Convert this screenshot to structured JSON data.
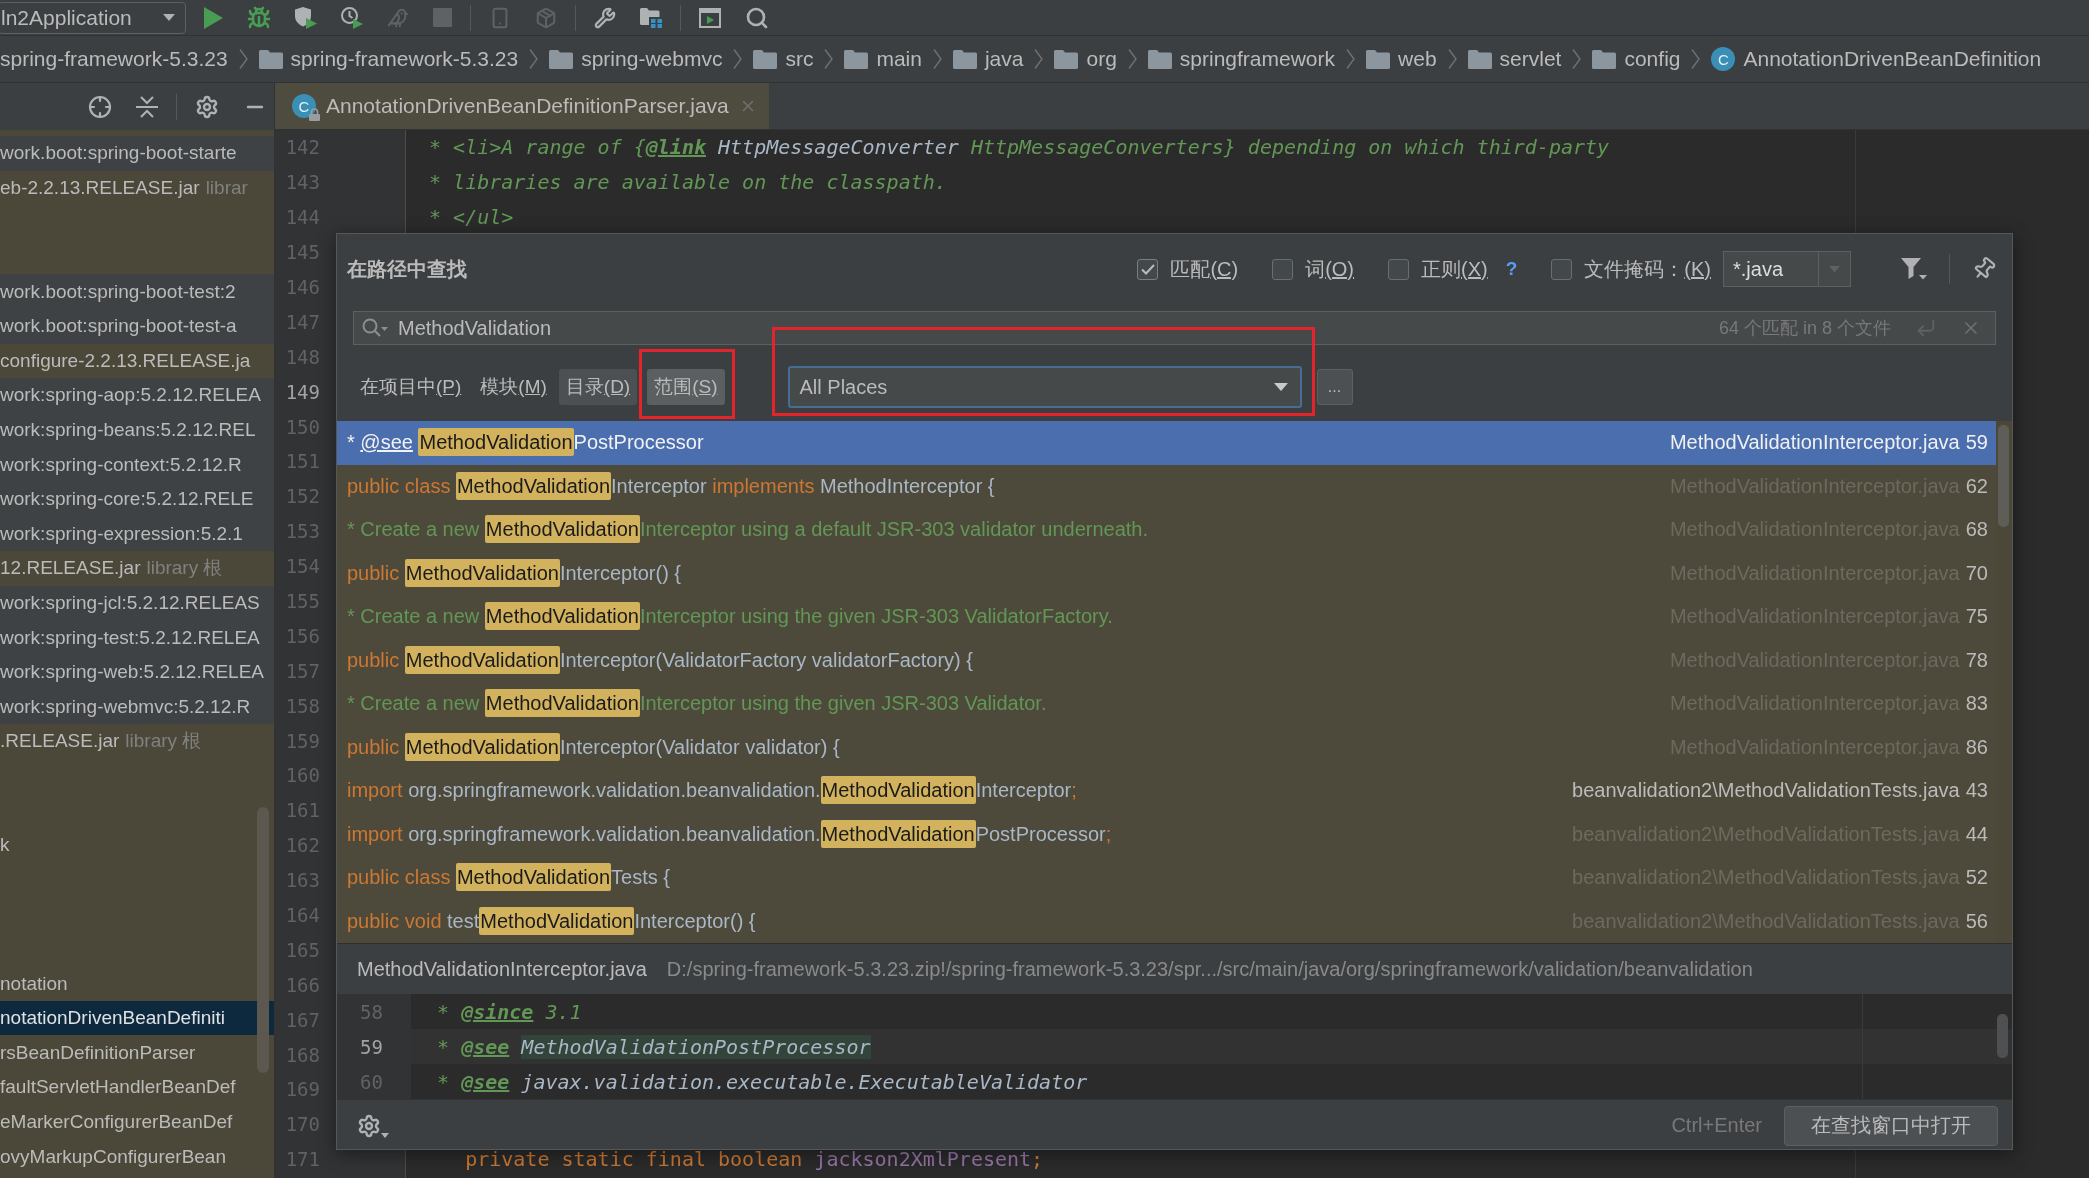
{
  "toolbar": {
    "run_config": "ln2Application",
    "groups": [
      {
        "tools": [
          {
            "kind": "run",
            "disabled": false
          },
          {
            "kind": "debug",
            "disabled": false
          },
          {
            "kind": "coverage",
            "disabled": false
          },
          {
            "kind": "profile",
            "disabled": false
          },
          {
            "kind": "attach",
            "disabled": true
          },
          {
            "kind": "stop",
            "disabled": true
          }
        ]
      },
      {
        "tools": [
          {
            "kind": "device",
            "disabled": true
          },
          {
            "kind": "package",
            "disabled": true
          }
        ]
      },
      {
        "tools": [
          {
            "kind": "wrench",
            "disabled": false
          },
          {
            "kind": "structure",
            "disabled": false
          }
        ]
      },
      {
        "tools": [
          {
            "kind": "window",
            "disabled": false
          },
          {
            "kind": "search",
            "disabled": false
          }
        ]
      }
    ]
  },
  "breadcrumb": [
    {
      "kind": "plain",
      "label": "spring-framework-5.3.23"
    },
    {
      "kind": "folder",
      "label": "spring-framework-5.3.23"
    },
    {
      "kind": "folder",
      "label": "spring-webmvc"
    },
    {
      "kind": "folder",
      "label": "src"
    },
    {
      "kind": "folder",
      "label": "main"
    },
    {
      "kind": "folder",
      "label": "java"
    },
    {
      "kind": "folder",
      "label": "org"
    },
    {
      "kind": "folder",
      "label": "springframework"
    },
    {
      "kind": "folder",
      "label": "web"
    },
    {
      "kind": "folder",
      "label": "servlet"
    },
    {
      "kind": "folder",
      "label": "config"
    },
    {
      "kind": "class",
      "badge": "C",
      "label": "AnnotationDrivenBeanDefinition"
    }
  ],
  "project": {
    "tool_groups": [
      {
        "tools": [
          {
            "kind": "locate"
          },
          {
            "kind": "collapse"
          }
        ]
      },
      {
        "tools": [
          {
            "kind": "settings"
          },
          {
            "kind": "hide"
          }
        ]
      }
    ],
    "rows": [
      {
        "text": "work.boot:spring-boot-starte",
        "color": "#3f4244",
        "selected": false
      },
      {
        "text": "eb-2.2.13.RELEASE.jar",
        "suffix": "librar",
        "color": "#4b4739",
        "selected": false
      },
      {
        "selected": false
      },
      {
        "selected": false
      },
      {
        "text": "work.boot:spring-boot-test:2",
        "color": "#3f4244",
        "selected": false
      },
      {
        "text": "work.boot:spring-boot-test-a",
        "color": "#3f4244",
        "selected": false
      },
      {
        "text": "configure-2.2.13.RELEASE.ja",
        "color": "#4b4739",
        "selected": false
      },
      {
        "text": "work:spring-aop:5.2.12.RELEA",
        "color": "#3f4244",
        "selected": false
      },
      {
        "text": "work:spring-beans:5.2.12.REL",
        "color": "#3f4244",
        "selected": false
      },
      {
        "text": "work:spring-context:5.2.12.R",
        "color": "#3f4244",
        "selected": false
      },
      {
        "text": "work:spring-core:5.2.12.RELE",
        "color": "#3f4244",
        "selected": false
      },
      {
        "text": "work:spring-expression:5.2.1",
        "color": "#3f4244",
        "selected": false
      },
      {
        "text": "12.RELEASE.jar",
        "suffix": "library 根",
        "color": "#4b4739",
        "selected": false
      },
      {
        "text": "work:spring-jcl:5.2.12.RELEAS",
        "color": "#3f4244",
        "selected": false
      },
      {
        "text": "work:spring-test:5.2.12.RELEA",
        "color": "#3f4244",
        "selected": false
      },
      {
        "text": "work:spring-web:5.2.12.RELEA",
        "color": "#3f4244",
        "selected": false
      },
      {
        "text": "work:spring-webmvc:5.2.12.R",
        "color": "#3f4244",
        "selected": false
      },
      {
        "text": ".RELEASE.jar",
        "suffix": "library 根",
        "color": "#4b4739",
        "selected": false
      },
      {
        "selected": false
      },
      {
        "selected": false
      },
      {
        "text": "k",
        "color": "#4b4739",
        "selected": false
      },
      {
        "selected": false
      },
      {
        "selected": false
      },
      {
        "selected": false
      },
      {
        "text": "notation",
        "color": "#4b4739",
        "selected": false
      },
      {
        "text": "notationDrivenBeanDefiniti",
        "selected": true
      },
      {
        "text": "rsBeanDefinitionParser",
        "color": "#4b4739",
        "selected": false
      },
      {
        "text": "faultServletHandlerBeanDef",
        "color": "#4b4739",
        "selected": false
      },
      {
        "text": "eMarkerConfigurerBeanDef",
        "color": "#4b4739",
        "selected": false
      },
      {
        "text": "ovyMarkupConfigurerBean",
        "color": "#4b4739",
        "selected": false
      }
    ]
  },
  "file_tab": {
    "badge": "C",
    "label": "AnnotationDrivenBeanDefinitionParser.java",
    "locked": true
  },
  "editor": {
    "lines": [
      {
        "number": "142",
        "current": false,
        "segments": [
          {
            "kind": "comment",
            "text": " * <li>A range of {"
          },
          {
            "kind": "tag",
            "text": "@link"
          },
          {
            "kind": "ref",
            "text": " HttpMessageConverter"
          },
          {
            "kind": "comment",
            "text": " HttpMessageConverters} depending on which third-party"
          }
        ]
      },
      {
        "number": "143",
        "current": false,
        "segments": [
          {
            "kind": "comment",
            "text": " * libraries are available on the classpath."
          }
        ]
      },
      {
        "number": "144",
        "current": false,
        "segments": [
          {
            "kind": "comment",
            "text": " * </ul>"
          }
        ]
      },
      {
        "number": "145",
        "current": false
      },
      {
        "number": "146",
        "current": false
      },
      {
        "number": "147",
        "current": false
      },
      {
        "number": "148",
        "current": false
      },
      {
        "number": "149",
        "current": true
      },
      {
        "number": "150",
        "current": false
      },
      {
        "number": "151",
        "current": false
      },
      {
        "number": "152",
        "current": false
      },
      {
        "number": "153",
        "current": false
      },
      {
        "number": "154",
        "current": false
      },
      {
        "number": "155",
        "current": false
      },
      {
        "number": "156",
        "current": false
      },
      {
        "number": "157",
        "current": false
      },
      {
        "number": "158",
        "current": false
      },
      {
        "number": "159",
        "current": false
      },
      {
        "number": "160",
        "current": false
      },
      {
        "number": "161",
        "current": false
      },
      {
        "number": "162",
        "current": false
      },
      {
        "number": "163",
        "current": false
      },
      {
        "number": "164",
        "current": false
      },
      {
        "number": "165",
        "current": false
      },
      {
        "number": "166",
        "current": false
      },
      {
        "number": "167",
        "current": false
      },
      {
        "number": "168",
        "current": false
      },
      {
        "number": "169",
        "current": false
      },
      {
        "number": "170",
        "current": false
      },
      {
        "number": "171",
        "current": false,
        "segments": [
          {
            "kind": "keyword",
            "text": "    private static final boolean "
          },
          {
            "kind": "field",
            "text": "jackson2XmlPresent"
          },
          {
            "kind": "keyword",
            "text": ";"
          }
        ]
      }
    ]
  },
  "find": {
    "title": "在路径中查找",
    "options": [
      {
        "label": "匹配",
        "mnemonic": "(C)",
        "checked": true
      },
      {
        "label": "词",
        "mnemonic": "(O)",
        "checked": false
      },
      {
        "label": "正则",
        "mnemonic": "(X)",
        "checked": false,
        "help": "?"
      },
      {
        "label": "文件掩码：",
        "mnemonic": "(K)",
        "checked": false
      }
    ],
    "file_mask": "*.java",
    "query": "MethodValidation",
    "summary": "64 个匹配 in 8 个文件",
    "scopes": [
      {
        "label": "在项目中",
        "mnemonic": "(P)",
        "selected": false,
        "hovered": false,
        "marked": false
      },
      {
        "label": "模块",
        "mnemonic": "(M)",
        "selected": false,
        "hovered": false,
        "marked": false
      },
      {
        "label": "目录",
        "mnemonic": "(D)",
        "selected": false,
        "hovered": true,
        "marked": false
      },
      {
        "label": "范围",
        "mnemonic": "(S)",
        "selected": true,
        "hovered": false,
        "marked": true
      }
    ],
    "scope_select": {
      "value": "All Places",
      "marked": true
    },
    "more_button": "...",
    "results": [
      {
        "selected": true,
        "segments": [
          {
            "kind": "comment",
            "text": "* "
          },
          {
            "kind": "tag",
            "text": "@see "
          },
          {
            "kind": "match",
            "text": "MethodValidation"
          },
          {
            "kind": "ref",
            "text": "PostProcessor"
          }
        ],
        "file": "MethodValidationInterceptor.java",
        "muted": false,
        "line": "59"
      },
      {
        "selected": false,
        "segments": [
          {
            "kind": "keyword",
            "text": "public class "
          },
          {
            "kind": "match",
            "text": "MethodValidation"
          },
          {
            "kind": "plain",
            "text": "Interceptor "
          },
          {
            "kind": "keyword",
            "text": "implements "
          },
          {
            "kind": "plain",
            "text": "MethodInterceptor {"
          }
        ],
        "file": "MethodValidationInterceptor.java",
        "muted": true,
        "line": "62"
      },
      {
        "selected": false,
        "segments": [
          {
            "kind": "comment",
            "text": "* Create a new "
          },
          {
            "kind": "match",
            "text": "MethodValidation"
          },
          {
            "kind": "comment",
            "text": "Interceptor using a default JSR-303 validator underneath."
          }
        ],
        "file": "MethodValidationInterceptor.java",
        "muted": true,
        "line": "68"
      },
      {
        "selected": false,
        "segments": [
          {
            "kind": "keyword",
            "text": "public "
          },
          {
            "kind": "match",
            "text": "MethodValidation"
          },
          {
            "kind": "plain",
            "text": "Interceptor() {"
          }
        ],
        "file": "MethodValidationInterceptor.java",
        "muted": true,
        "line": "70"
      },
      {
        "selected": false,
        "segments": [
          {
            "kind": "comment",
            "text": "* Create a new "
          },
          {
            "kind": "match",
            "text": "MethodValidation"
          },
          {
            "kind": "comment",
            "text": "Interceptor using the given JSR-303 ValidatorFactory."
          }
        ],
        "file": "MethodValidationInterceptor.java",
        "muted": true,
        "line": "75"
      },
      {
        "selected": false,
        "segments": [
          {
            "kind": "keyword",
            "text": "public "
          },
          {
            "kind": "match",
            "text": "MethodValidation"
          },
          {
            "kind": "plain",
            "text": "Interceptor(ValidatorFactory validatorFactory) {"
          }
        ],
        "file": "MethodValidationInterceptor.java",
        "muted": true,
        "line": "78"
      },
      {
        "selected": false,
        "segments": [
          {
            "kind": "comment",
            "text": "* Create a new "
          },
          {
            "kind": "match",
            "text": "MethodValidation"
          },
          {
            "kind": "comment",
            "text": "Interceptor using the given JSR-303 Validator."
          }
        ],
        "file": "MethodValidationInterceptor.java",
        "muted": true,
        "line": "83"
      },
      {
        "selected": false,
        "segments": [
          {
            "kind": "keyword",
            "text": "public "
          },
          {
            "kind": "match",
            "text": "MethodValidation"
          },
          {
            "kind": "plain",
            "text": "Interceptor(Validator validator) {"
          }
        ],
        "file": "MethodValidationInterceptor.java",
        "muted": true,
        "line": "86"
      },
      {
        "selected": false,
        "segments": [
          {
            "kind": "keyword",
            "text": "import "
          },
          {
            "kind": "plain",
            "text": "org.springframework.validation.beanvalidation."
          },
          {
            "kind": "match",
            "text": "MethodValidation"
          },
          {
            "kind": "plain",
            "text": "Interceptor"
          },
          {
            "kind": "keyword",
            "text": ";"
          }
        ],
        "file": "beanvalidation2\\MethodValidationTests.java",
        "muted": false,
        "line": "43"
      },
      {
        "selected": false,
        "segments": [
          {
            "kind": "keyword",
            "text": "import "
          },
          {
            "kind": "plain",
            "text": "org.springframework.validation.beanvalidation."
          },
          {
            "kind": "match",
            "text": "MethodValidation"
          },
          {
            "kind": "plain",
            "text": "PostProcessor"
          },
          {
            "kind": "keyword",
            "text": ";"
          }
        ],
        "file": "beanvalidation2\\MethodValidationTests.java",
        "muted": true,
        "line": "44"
      },
      {
        "selected": false,
        "segments": [
          {
            "kind": "keyword",
            "text": "public class "
          },
          {
            "kind": "match",
            "text": "MethodValidation"
          },
          {
            "kind": "plain",
            "text": "Tests {"
          }
        ],
        "file": "beanvalidation2\\MethodValidationTests.java",
        "muted": true,
        "line": "52"
      },
      {
        "selected": false,
        "segments": [
          {
            "kind": "keyword",
            "text": "public void "
          },
          {
            "kind": "plain",
            "text": "test"
          },
          {
            "kind": "match",
            "text": "MethodValidation"
          },
          {
            "kind": "plain",
            "text": "Interceptor() {"
          }
        ],
        "file": "beanvalidation2\\MethodValidationTests.java",
        "muted": true,
        "line": "56"
      }
    ],
    "preview": {
      "file": "MethodValidationInterceptor.java",
      "path": "D:/spring-framework-5.3.23.zip!/spring-framework-5.3.23/spr.../src/main/java/org/springframework/validation/beanvalidation",
      "lines": [
        {
          "number": "58",
          "current": false,
          "segments": [
            {
              "kind": "comment",
              "text": " * "
            },
            {
              "kind": "tag",
              "text": "@since"
            },
            {
              "kind": "comment",
              "text": " 3.1"
            }
          ]
        },
        {
          "number": "59",
          "current": true,
          "segments": [
            {
              "kind": "comment",
              "text": " * "
            },
            {
              "kind": "tag",
              "text": "@see "
            },
            {
              "kind": "found",
              "text": "MethodValidationPostProcessor"
            }
          ]
        },
        {
          "number": "60",
          "current": false,
          "segments": [
            {
              "kind": "comment",
              "text": " * "
            },
            {
              "kind": "tag",
              "text": "@see "
            },
            {
              "kind": "ref",
              "text": "javax.validation.executable.ExecutableValidator"
            }
          ]
        }
      ]
    },
    "shortcut": "Ctrl+Enter",
    "open_button": "在查找窗口中打开"
  }
}
